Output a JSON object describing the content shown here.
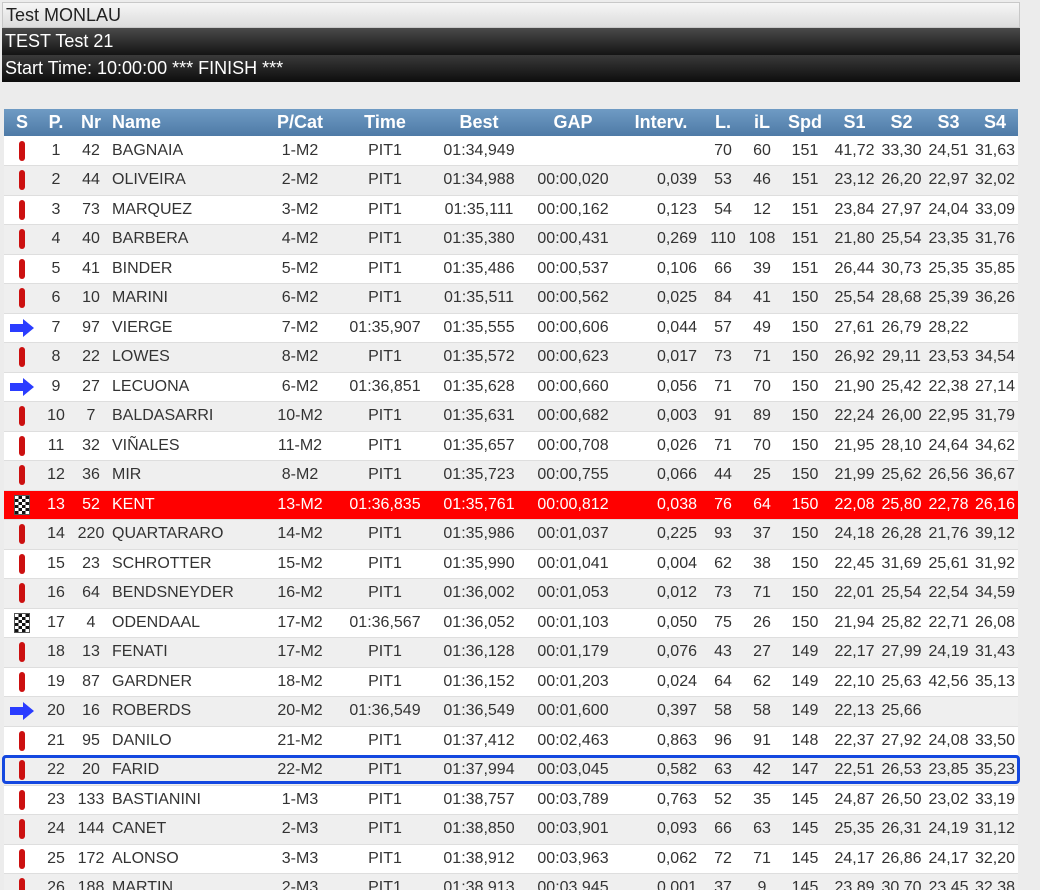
{
  "header": {
    "event": "Test MONLAU",
    "session": "TEST Test 21",
    "status": "Start Time: 10:00:00 *** FINISH ***"
  },
  "columns": [
    "S",
    "P.",
    "Nr",
    "Name",
    "P/Cat",
    "Time",
    "Best",
    "GAP",
    "Interv.",
    "L.",
    "iL",
    "Spd",
    "S1",
    "S2",
    "S3",
    "S4"
  ],
  "icons": {
    "pit": "pit-icon",
    "arrow": "arrow-right-icon",
    "flag": "checkered-flag-icon"
  },
  "colors": {
    "highlight": "#ff0000",
    "pit": "#cc1010",
    "arrow": "#2a3cff",
    "selection": "#1448e0"
  },
  "rows": [
    {
      "s": "pit",
      "p": "1",
      "nr": "42",
      "name": "BAGNAIA",
      "cat": "1-M2",
      "time": "PIT1",
      "best": "01:34,949",
      "gap": "",
      "int": "",
      "l": "70",
      "il": "60",
      "spd": "151",
      "s1": "41,72",
      "s2": "33,30",
      "s3": "24,51",
      "s4": "31,63"
    },
    {
      "s": "pit",
      "p": "2",
      "nr": "44",
      "name": "OLIVEIRA",
      "cat": "2-M2",
      "time": "PIT1",
      "best": "01:34,988",
      "gap": "00:00,020",
      "int": "0,039",
      "l": "53",
      "il": "46",
      "spd": "151",
      "s1": "23,12",
      "s2": "26,20",
      "s3": "22,97",
      "s4": "32,02"
    },
    {
      "s": "pit",
      "p": "3",
      "nr": "73",
      "name": "MARQUEZ",
      "cat": "3-M2",
      "time": "PIT1",
      "best": "01:35,111",
      "gap": "00:00,162",
      "int": "0,123",
      "l": "54",
      "il": "12",
      "spd": "151",
      "s1": "23,84",
      "s2": "27,97",
      "s3": "24,04",
      "s4": "33,09"
    },
    {
      "s": "pit",
      "p": "4",
      "nr": "40",
      "name": "BARBERA",
      "cat": "4-M2",
      "time": "PIT1",
      "best": "01:35,380",
      "gap": "00:00,431",
      "int": "0,269",
      "l": "110",
      "il": "108",
      "spd": "151",
      "s1": "21,80",
      "s2": "25,54",
      "s3": "23,35",
      "s4": "31,76"
    },
    {
      "s": "pit",
      "p": "5",
      "nr": "41",
      "name": "BINDER",
      "cat": "5-M2",
      "time": "PIT1",
      "best": "01:35,486",
      "gap": "00:00,537",
      "int": "0,106",
      "l": "66",
      "il": "39",
      "spd": "151",
      "s1": "26,44",
      "s2": "30,73",
      "s3": "25,35",
      "s4": "35,85"
    },
    {
      "s": "pit",
      "p": "6",
      "nr": "10",
      "name": "MARINI",
      "cat": "6-M2",
      "time": "PIT1",
      "best": "01:35,511",
      "gap": "00:00,562",
      "int": "0,025",
      "l": "84",
      "il": "41",
      "spd": "150",
      "s1": "25,54",
      "s2": "28,68",
      "s3": "25,39",
      "s4": "36,26"
    },
    {
      "s": "arrow",
      "p": "7",
      "nr": "97",
      "name": "VIERGE",
      "cat": "7-M2",
      "time": "01:35,907",
      "best": "01:35,555",
      "gap": "00:00,606",
      "int": "0,044",
      "l": "57",
      "il": "49",
      "spd": "150",
      "s1": "27,61",
      "s2": "26,79",
      "s3": "28,22",
      "s4": ""
    },
    {
      "s": "pit",
      "p": "8",
      "nr": "22",
      "name": "LOWES",
      "cat": "8-M2",
      "time": "PIT1",
      "best": "01:35,572",
      "gap": "00:00,623",
      "int": "0,017",
      "l": "73",
      "il": "71",
      "spd": "150",
      "s1": "26,92",
      "s2": "29,11",
      "s3": "23,53",
      "s4": "34,54"
    },
    {
      "s": "arrow",
      "p": "9",
      "nr": "27",
      "name": "LECUONA",
      "cat": "6-M2",
      "time": "01:36,851",
      "best": "01:35,628",
      "gap": "00:00,660",
      "int": "0,056",
      "l": "71",
      "il": "70",
      "spd": "150",
      "s1": "21,90",
      "s2": "25,42",
      "s3": "22,38",
      "s4": "27,14"
    },
    {
      "s": "pit",
      "p": "10",
      "nr": "7",
      "name": "BALDASARRI",
      "cat": "10-M2",
      "time": "PIT1",
      "best": "01:35,631",
      "gap": "00:00,682",
      "int": "0,003",
      "l": "91",
      "il": "89",
      "spd": "150",
      "s1": "22,24",
      "s2": "26,00",
      "s3": "22,95",
      "s4": "31,79"
    },
    {
      "s": "pit",
      "p": "11",
      "nr": "32",
      "name": "VIÑALES",
      "cat": "11-M2",
      "time": "PIT1",
      "best": "01:35,657",
      "gap": "00:00,708",
      "int": "0,026",
      "l": "71",
      "il": "70",
      "spd": "150",
      "s1": "21,95",
      "s2": "28,10",
      "s3": "24,64",
      "s4": "34,62"
    },
    {
      "s": "pit",
      "p": "12",
      "nr": "36",
      "name": "MIR",
      "cat": "8-M2",
      "time": "PIT1",
      "best": "01:35,723",
      "gap": "00:00,755",
      "int": "0,066",
      "l": "44",
      "il": "25",
      "spd": "150",
      "s1": "21,99",
      "s2": "25,62",
      "s3": "26,56",
      "s4": "36,67"
    },
    {
      "s": "flag",
      "p": "13",
      "nr": "52",
      "name": "KENT",
      "cat": "13-M2",
      "time": "01:36,835",
      "best": "01:35,761",
      "gap": "00:00,812",
      "int": "0,038",
      "l": "76",
      "il": "64",
      "spd": "150",
      "s1": "22,08",
      "s2": "25,80",
      "s3": "22,78",
      "s4": "26,16",
      "highlight": true
    },
    {
      "s": "pit",
      "p": "14",
      "nr": "220",
      "name": "QUARTARARO",
      "cat": "14-M2",
      "time": "PIT1",
      "best": "01:35,986",
      "gap": "00:01,037",
      "int": "0,225",
      "l": "93",
      "il": "37",
      "spd": "150",
      "s1": "24,18",
      "s2": "26,28",
      "s3": "21,76",
      "s4": "39,12"
    },
    {
      "s": "pit",
      "p": "15",
      "nr": "23",
      "name": "SCHROTTER",
      "cat": "15-M2",
      "time": "PIT1",
      "best": "01:35,990",
      "gap": "00:01,041",
      "int": "0,004",
      "l": "62",
      "il": "38",
      "spd": "150",
      "s1": "22,45",
      "s2": "31,69",
      "s3": "25,61",
      "s4": "31,92"
    },
    {
      "s": "pit",
      "p": "16",
      "nr": "64",
      "name": "BENDSNEYDER",
      "cat": "16-M2",
      "time": "PIT1",
      "best": "01:36,002",
      "gap": "00:01,053",
      "int": "0,012",
      "l": "73",
      "il": "71",
      "spd": "150",
      "s1": "22,01",
      "s2": "25,54",
      "s3": "22,54",
      "s4": "34,59"
    },
    {
      "s": "flag",
      "p": "17",
      "nr": "4",
      "name": "ODENDAAL",
      "cat": "17-M2",
      "time": "01:36,567",
      "best": "01:36,052",
      "gap": "00:01,103",
      "int": "0,050",
      "l": "75",
      "il": "26",
      "spd": "150",
      "s1": "21,94",
      "s2": "25,82",
      "s3": "22,71",
      "s4": "26,08"
    },
    {
      "s": "pit",
      "p": "18",
      "nr": "13",
      "name": "FENATI",
      "cat": "17-M2",
      "time": "PIT1",
      "best": "01:36,128",
      "gap": "00:01,179",
      "int": "0,076",
      "l": "43",
      "il": "27",
      "spd": "149",
      "s1": "22,17",
      "s2": "27,99",
      "s3": "24,19",
      "s4": "31,43"
    },
    {
      "s": "pit",
      "p": "19",
      "nr": "87",
      "name": "GARDNER",
      "cat": "18-M2",
      "time": "PIT1",
      "best": "01:36,152",
      "gap": "00:01,203",
      "int": "0,024",
      "l": "64",
      "il": "62",
      "spd": "149",
      "s1": "22,10",
      "s2": "25,63",
      "s3": "42,56",
      "s4": "35,13"
    },
    {
      "s": "arrow",
      "p": "20",
      "nr": "16",
      "name": "ROBERDS",
      "cat": "20-M2",
      "time": "01:36,549",
      "best": "01:36,549",
      "gap": "00:01,600",
      "int": "0,397",
      "l": "58",
      "il": "58",
      "spd": "149",
      "s1": "22,13",
      "s2": "25,66",
      "s3": "",
      "s4": ""
    },
    {
      "s": "pit",
      "p": "21",
      "nr": "95",
      "name": "DANILO",
      "cat": "21-M2",
      "time": "PIT1",
      "best": "01:37,412",
      "gap": "00:02,463",
      "int": "0,863",
      "l": "96",
      "il": "91",
      "spd": "148",
      "s1": "22,37",
      "s2": "27,92",
      "s3": "24,08",
      "s4": "33,50"
    },
    {
      "s": "pit",
      "p": "22",
      "nr": "20",
      "name": "FARID",
      "cat": "22-M2",
      "time": "PIT1",
      "best": "01:37,994",
      "gap": "00:03,045",
      "int": "0,582",
      "l": "63",
      "il": "42",
      "spd": "147",
      "s1": "22,51",
      "s2": "26,53",
      "s3": "23,85",
      "s4": "35,23",
      "selected": true
    },
    {
      "s": "pit",
      "p": "23",
      "nr": "133",
      "name": "BASTIANINI",
      "cat": "1-M3",
      "time": "PIT1",
      "best": "01:38,757",
      "gap": "00:03,789",
      "int": "0,763",
      "l": "52",
      "il": "35",
      "spd": "145",
      "s1": "24,87",
      "s2": "26,50",
      "s3": "23,02",
      "s4": "33,19"
    },
    {
      "s": "pit",
      "p": "24",
      "nr": "144",
      "name": "CANET",
      "cat": "2-M3",
      "time": "PIT1",
      "best": "01:38,850",
      "gap": "00:03,901",
      "int": "0,093",
      "l": "66",
      "il": "63",
      "spd": "145",
      "s1": "25,35",
      "s2": "26,31",
      "s3": "24,19",
      "s4": "31,12"
    },
    {
      "s": "pit",
      "p": "25",
      "nr": "172",
      "name": "ALONSO",
      "cat": "3-M3",
      "time": "PIT1",
      "best": "01:38,912",
      "gap": "00:03,963",
      "int": "0,062",
      "l": "72",
      "il": "71",
      "spd": "145",
      "s1": "24,17",
      "s2": "26,86",
      "s3": "24,17",
      "s4": "32,20"
    },
    {
      "s": "pit",
      "p": "26",
      "nr": "188",
      "name": "MARTIN",
      "cat": "2-M3",
      "time": "PIT1",
      "best": "01:38,913",
      "gap": "00:03,945",
      "int": "0,001",
      "l": "37",
      "il": "9",
      "spd": "145",
      "s1": "23,89",
      "s2": "30,70",
      "s3": "23,45",
      "s4": "32,38"
    }
  ]
}
